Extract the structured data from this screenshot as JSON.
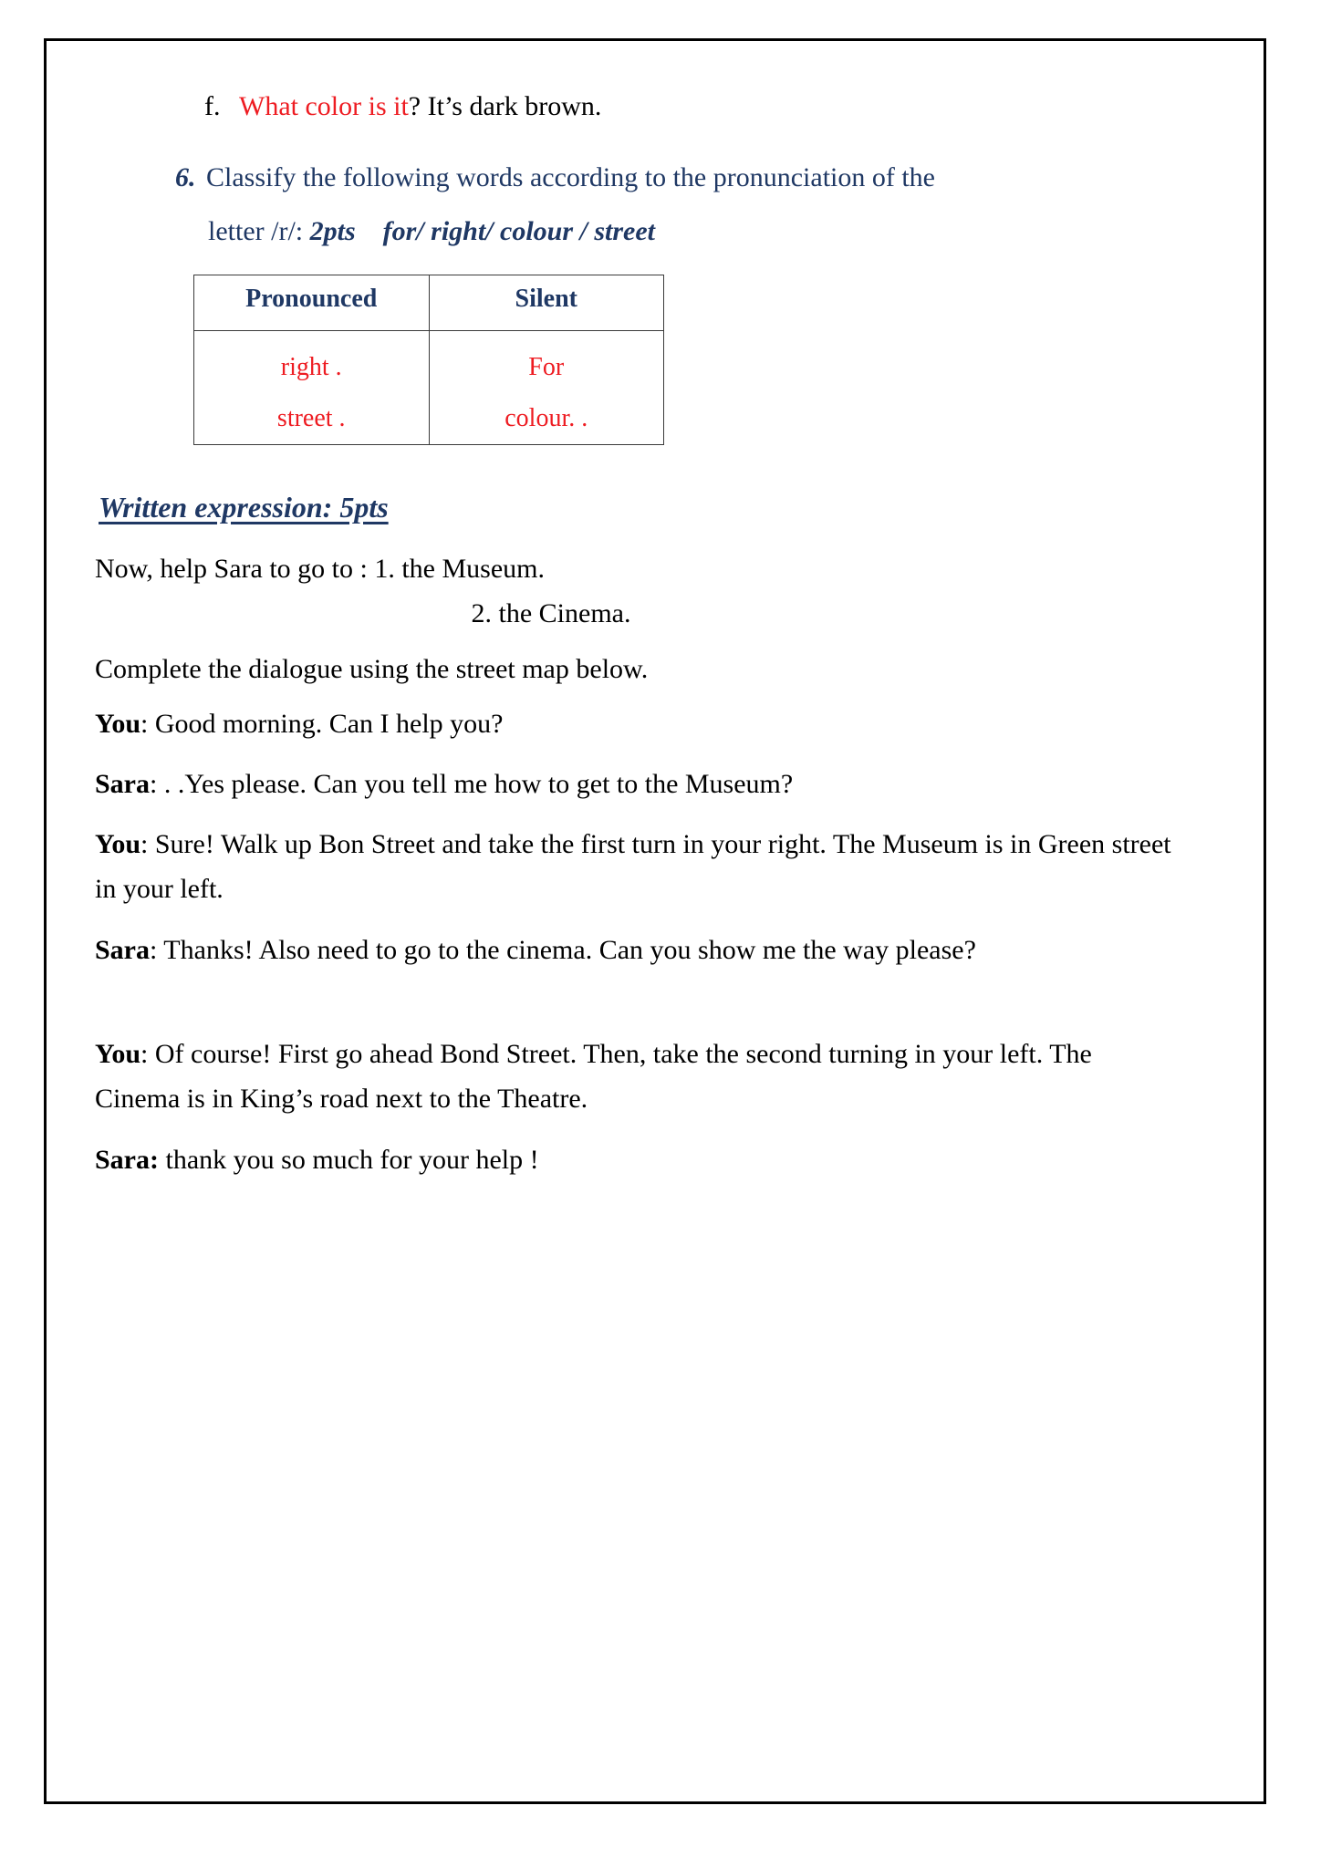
{
  "item_f": {
    "marker": "f.",
    "question": "What color is it",
    "answer": "? It’s dark brown."
  },
  "item_6": {
    "number": "6.",
    "instruction": "Classify the following  words according to the pronunciation of the",
    "line2_prefix": "letter /r/:",
    "points": "2pts",
    "words": "for/ right/ colour / street"
  },
  "table": {
    "headers": [
      "Pronounced",
      "Silent"
    ],
    "rows": [
      [
        "right .",
        "For"
      ],
      [
        "street .",
        "colour. ."
      ]
    ]
  },
  "written_expression": {
    "heading": "Written expression: 5pts",
    "intro": "Now, help Sara to go to : 1.   the Museum.",
    "intro_second": "2. the Cinema.",
    "instruction": "Complete the dialogue using the street map below."
  },
  "dialogue": [
    {
      "speaker": "You",
      "sep": ": ",
      "text": "Good morning. Can I help you?"
    },
    {
      "speaker": "Sara",
      "sep": ": ",
      "text": ". .Yes please. Can you tell me how to get to the Museum?"
    },
    {
      "speaker": "You",
      "sep": ": ",
      "text": "Sure! Walk up Bon Street and take the first turn in your right. The Museum is in Green street in your left."
    },
    {
      "speaker": "Sara",
      "sep": ": ",
      "text": "Thanks!  Also need to go to the cinema. Can you show me the way please?"
    },
    {
      "speaker": "You",
      "sep": ": ",
      "text": "Of course! First go ahead Bond Street. Then, take the second turning in your left. The Cinema is in King’s road next to the Theatre."
    },
    {
      "speaker": "Sara:",
      "sep": " ",
      "text": "thank you so much for your help !"
    }
  ],
  "colors": {
    "navy": "#1F3864",
    "red": "#EE1C22",
    "black": "#000000"
  }
}
